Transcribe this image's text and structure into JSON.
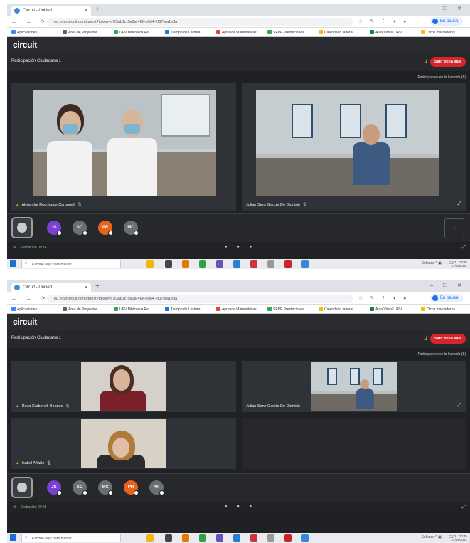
{
  "browser": {
    "tab_title": "Circuit - Unified",
    "new_tab": "+",
    "window_controls": "– ❐ ✕",
    "nav_controls": "← → ⟳",
    "url": "eu.yourcircuit.com/guest?token=c7f3ab1c-5e2a-4f9f-b0d4-2f07fea1e3a",
    "extension_icons": "☆ ✎ ⋮ ◐ ●",
    "profile_label": "En pausa",
    "bookmarks": [
      {
        "label": "Aplicaciones",
        "color": "#4285f4"
      },
      {
        "label": "Área de Proyectos",
        "color": "#5f6368"
      },
      {
        "label": "UPV Biblioteca Pe...",
        "color": "#34a853"
      },
      {
        "label": "Tiempo de Lectura",
        "color": "#1a73e8"
      },
      {
        "label": "Aprende Matemáticas",
        "color": "#ea4335"
      },
      {
        "label": "SEPE Prestaciones",
        "color": "#34a853"
      },
      {
        "label": "Calendario laboral",
        "color": "#fbbc04"
      },
      {
        "label": "Aula Virtual UPV",
        "color": "#188038"
      },
      {
        "label": "Otros marcadores",
        "color": "#fbbc04"
      }
    ]
  },
  "app": {
    "logo": "circuit",
    "conference_title": "Participación Ciudadana 1",
    "leave_label": "Salir de la sala",
    "minimize_icon": "⤓",
    "participant_count": "Participantes en la llamada (8)"
  },
  "screenshot1": {
    "tiles": [
      {
        "name": "Alejandra Rodríguez Carbonell",
        "warning": "▲",
        "mic": "🎙"
      },
      {
        "name": "Julian Sanz García De Dionisio",
        "warning": "",
        "mic": "🎙"
      }
    ],
    "avatars": [
      {
        "initials": "JS",
        "color": "#7b3fd6"
      },
      {
        "initials": "SC",
        "color": "#6b6f74"
      },
      {
        "initials": "PR",
        "color": "#e8631c"
      },
      {
        "initials": "MC",
        "color": "#6b6f74"
      }
    ],
    "strip_end_label": "⋮",
    "status_text": "Grabación 00:14",
    "status_mid": "● ● ●",
    "status_right": "⤢"
  },
  "screenshot2": {
    "tiles": [
      {
        "name": "Rosa Carbonell Beanes",
        "warning": "▲",
        "mic": "🎙"
      },
      {
        "name": "Julian Sanz García De Dionisio",
        "warning": "",
        "mic": ""
      },
      {
        "name": "Isabel Añaño",
        "warning": "▲",
        "mic": "🎙"
      }
    ],
    "avatars": [
      {
        "initials": "JS",
        "color": "#7b3fd6"
      },
      {
        "initials": "SC",
        "color": "#6b6f74"
      },
      {
        "initials": "MC",
        "color": "#6b6f74"
      },
      {
        "initials": "PR",
        "color": "#e8631c"
      },
      {
        "initials": "AR",
        "color": "#6b6f74"
      }
    ],
    "status_text": "Grabación 00:28",
    "status_mid": "● ● ●",
    "status_right": "⤢"
  },
  "taskbar": {
    "search_placeholder": "Escribe aquí para buscar",
    "search_icon": "⌕",
    "tray_text": "Soleado  ^  ▣  ⌁  ◖  ESP",
    "time": "10:45",
    "date": "27/04/2021"
  }
}
